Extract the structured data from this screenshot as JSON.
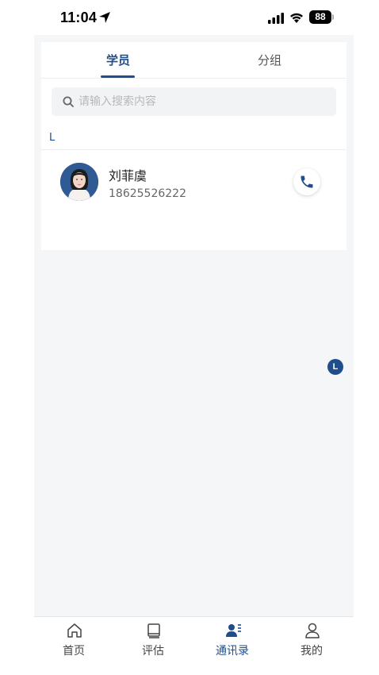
{
  "status_bar": {
    "time": "11:04",
    "battery": "88"
  },
  "tabs": [
    {
      "label": "学员",
      "active": true
    },
    {
      "label": "分组",
      "active": false
    }
  ],
  "search": {
    "placeholder": "请输入搜索内容",
    "value": ""
  },
  "section": {
    "letter": "L"
  },
  "contacts": [
    {
      "name": "刘菲虞",
      "phone": "18625526222"
    }
  ],
  "index_bar": {
    "current": "L"
  },
  "bottom_nav": [
    {
      "label": "首页",
      "icon": "home-icon",
      "active": false
    },
    {
      "label": "评估",
      "icon": "book-icon",
      "active": false
    },
    {
      "label": "通讯录",
      "icon": "contacts-icon",
      "active": true
    },
    {
      "label": "我的",
      "icon": "profile-icon",
      "active": false
    }
  ],
  "colors": {
    "accent": "#1f4e8c",
    "background": "#f5f6f8"
  }
}
